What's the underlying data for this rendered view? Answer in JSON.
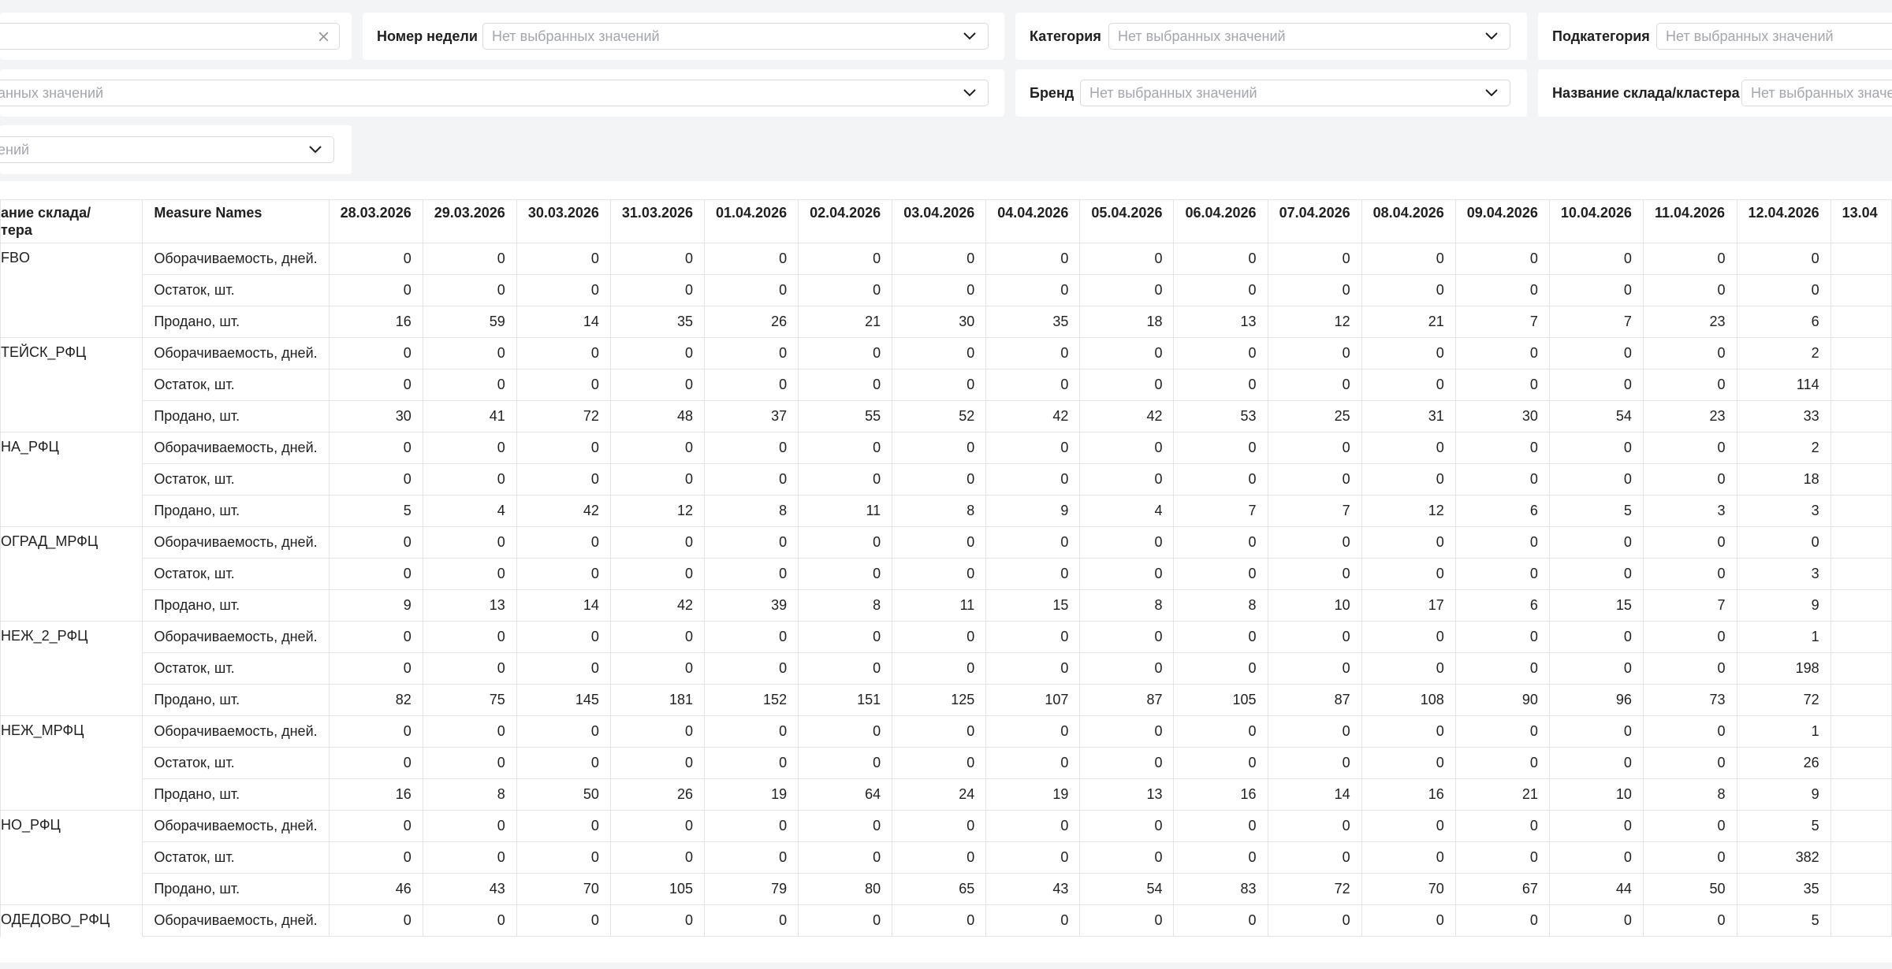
{
  "filters": {
    "row1": {
      "search_clear": "clear-icon",
      "week": {
        "label": "Номер недели",
        "placeholder": "Нет выбранных значений"
      },
      "category": {
        "label": "Категория",
        "placeholder": "Нет выбранных значений"
      },
      "subcategory": {
        "label": "Подкатегория",
        "placeholder": "Нет выбранных значений"
      }
    },
    "row2": {
      "partial": {
        "placeholder": "анных значений"
      },
      "brand": {
        "label": "Бренд",
        "placeholder": "Нет выбранных значений"
      },
      "warehouse": {
        "label": "Название склада/кластера",
        "placeholder": "Нет выбранных значе"
      }
    },
    "row3": {
      "partial": {
        "placeholder": "ений"
      }
    }
  },
  "table": {
    "header_wh": "ание склада/\nтера",
    "header_measure": "Measure Names",
    "dates": [
      "28.03.2026",
      "29.03.2026",
      "30.03.2026",
      "31.03.2026",
      "01.04.2026",
      "02.04.2026",
      "03.04.2026",
      "04.04.2026",
      "05.04.2026",
      "06.04.2026",
      "07.04.2026",
      "08.04.2026",
      "09.04.2026",
      "10.04.2026",
      "11.04.2026",
      "12.04.2026",
      "13.04"
    ],
    "groups": [
      {
        "name": "FBO",
        "rows": [
          {
            "measure": "Оборачиваемость, дней.",
            "values": [
              "0",
              "0",
              "0",
              "0",
              "0",
              "0",
              "0",
              "0",
              "0",
              "0",
              "0",
              "0",
              "0",
              "0",
              "0",
              "0",
              ""
            ]
          },
          {
            "measure": "Остаток, шт.",
            "values": [
              "0",
              "0",
              "0",
              "0",
              "0",
              "0",
              "0",
              "0",
              "0",
              "0",
              "0",
              "0",
              "0",
              "0",
              "0",
              "0",
              ""
            ]
          },
          {
            "measure": "Продано, шт.",
            "values": [
              "16",
              "59",
              "14",
              "35",
              "26",
              "21",
              "30",
              "35",
              "18",
              "13",
              "12",
              "21",
              "7",
              "7",
              "23",
              "6",
              ""
            ]
          }
        ]
      },
      {
        "name": "ТЕЙСК_РФЦ",
        "rows": [
          {
            "measure": "Оборачиваемость, дней.",
            "values": [
              "0",
              "0",
              "0",
              "0",
              "0",
              "0",
              "0",
              "0",
              "0",
              "0",
              "0",
              "0",
              "0",
              "0",
              "0",
              "2",
              ""
            ]
          },
          {
            "measure": "Остаток, шт.",
            "values": [
              "0",
              "0",
              "0",
              "0",
              "0",
              "0",
              "0",
              "0",
              "0",
              "0",
              "0",
              "0",
              "0",
              "0",
              "0",
              "114",
              ""
            ]
          },
          {
            "measure": "Продано, шт.",
            "values": [
              "30",
              "41",
              "72",
              "48",
              "37",
              "55",
              "52",
              "42",
              "42",
              "53",
              "25",
              "31",
              "30",
              "54",
              "23",
              "33",
              ""
            ]
          }
        ]
      },
      {
        "name": "НА_РФЦ",
        "rows": [
          {
            "measure": "Оборачиваемость, дней.",
            "values": [
              "0",
              "0",
              "0",
              "0",
              "0",
              "0",
              "0",
              "0",
              "0",
              "0",
              "0",
              "0",
              "0",
              "0",
              "0",
              "2",
              ""
            ]
          },
          {
            "measure": "Остаток, шт.",
            "values": [
              "0",
              "0",
              "0",
              "0",
              "0",
              "0",
              "0",
              "0",
              "0",
              "0",
              "0",
              "0",
              "0",
              "0",
              "0",
              "18",
              ""
            ]
          },
          {
            "measure": "Продано, шт.",
            "values": [
              "5",
              "4",
              "42",
              "12",
              "8",
              "11",
              "8",
              "9",
              "4",
              "7",
              "7",
              "12",
              "6",
              "5",
              "3",
              "3",
              ""
            ]
          }
        ]
      },
      {
        "name": "ОГРАД_МРФЦ",
        "rows": [
          {
            "measure": "Оборачиваемость, дней.",
            "values": [
              "0",
              "0",
              "0",
              "0",
              "0",
              "0",
              "0",
              "0",
              "0",
              "0",
              "0",
              "0",
              "0",
              "0",
              "0",
              "0",
              ""
            ]
          },
          {
            "measure": "Остаток, шт.",
            "values": [
              "0",
              "0",
              "0",
              "0",
              "0",
              "0",
              "0",
              "0",
              "0",
              "0",
              "0",
              "0",
              "0",
              "0",
              "0",
              "3",
              ""
            ]
          },
          {
            "measure": "Продано, шт.",
            "values": [
              "9",
              "13",
              "14",
              "42",
              "39",
              "8",
              "11",
              "15",
              "8",
              "8",
              "10",
              "17",
              "6",
              "15",
              "7",
              "9",
              ""
            ]
          }
        ]
      },
      {
        "name": "НЕЖ_2_РФЦ",
        "rows": [
          {
            "measure": "Оборачиваемость, дней.",
            "values": [
              "0",
              "0",
              "0",
              "0",
              "0",
              "0",
              "0",
              "0",
              "0",
              "0",
              "0",
              "0",
              "0",
              "0",
              "0",
              "1",
              ""
            ]
          },
          {
            "measure": "Остаток, шт.",
            "values": [
              "0",
              "0",
              "0",
              "0",
              "0",
              "0",
              "0",
              "0",
              "0",
              "0",
              "0",
              "0",
              "0",
              "0",
              "0",
              "198",
              ""
            ]
          },
          {
            "measure": "Продано, шт.",
            "values": [
              "82",
              "75",
              "145",
              "181",
              "152",
              "151",
              "125",
              "107",
              "87",
              "105",
              "87",
              "108",
              "90",
              "96",
              "73",
              "72",
              ""
            ]
          }
        ]
      },
      {
        "name": "НЕЖ_МРФЦ",
        "rows": [
          {
            "measure": "Оборачиваемость, дней.",
            "values": [
              "0",
              "0",
              "0",
              "0",
              "0",
              "0",
              "0",
              "0",
              "0",
              "0",
              "0",
              "0",
              "0",
              "0",
              "0",
              "1",
              ""
            ]
          },
          {
            "measure": "Остаток, шт.",
            "values": [
              "0",
              "0",
              "0",
              "0",
              "0",
              "0",
              "0",
              "0",
              "0",
              "0",
              "0",
              "0",
              "0",
              "0",
              "0",
              "26",
              ""
            ]
          },
          {
            "measure": "Продано, шт.",
            "values": [
              "16",
              "8",
              "50",
              "26",
              "19",
              "64",
              "24",
              "19",
              "13",
              "16",
              "14",
              "16",
              "21",
              "10",
              "8",
              "9",
              ""
            ]
          }
        ]
      },
      {
        "name": "НО_РФЦ",
        "rows": [
          {
            "measure": "Оборачиваемость, дней.",
            "values": [
              "0",
              "0",
              "0",
              "0",
              "0",
              "0",
              "0",
              "0",
              "0",
              "0",
              "0",
              "0",
              "0",
              "0",
              "0",
              "5",
              ""
            ]
          },
          {
            "measure": "Остаток, шт.",
            "values": [
              "0",
              "0",
              "0",
              "0",
              "0",
              "0",
              "0",
              "0",
              "0",
              "0",
              "0",
              "0",
              "0",
              "0",
              "0",
              "382",
              ""
            ]
          },
          {
            "measure": "Продано, шт.",
            "values": [
              "46",
              "43",
              "70",
              "105",
              "79",
              "80",
              "65",
              "43",
              "54",
              "83",
              "72",
              "70",
              "67",
              "44",
              "50",
              "35",
              ""
            ]
          }
        ]
      },
      {
        "name": "ОДЕДОВО_РФЦ",
        "rows": [
          {
            "measure": "Оборачиваемость, дней.",
            "values": [
              "0",
              "0",
              "0",
              "0",
              "0",
              "0",
              "0",
              "0",
              "0",
              "0",
              "0",
              "0",
              "0",
              "0",
              "0",
              "5",
              ""
            ]
          }
        ]
      }
    ]
  }
}
